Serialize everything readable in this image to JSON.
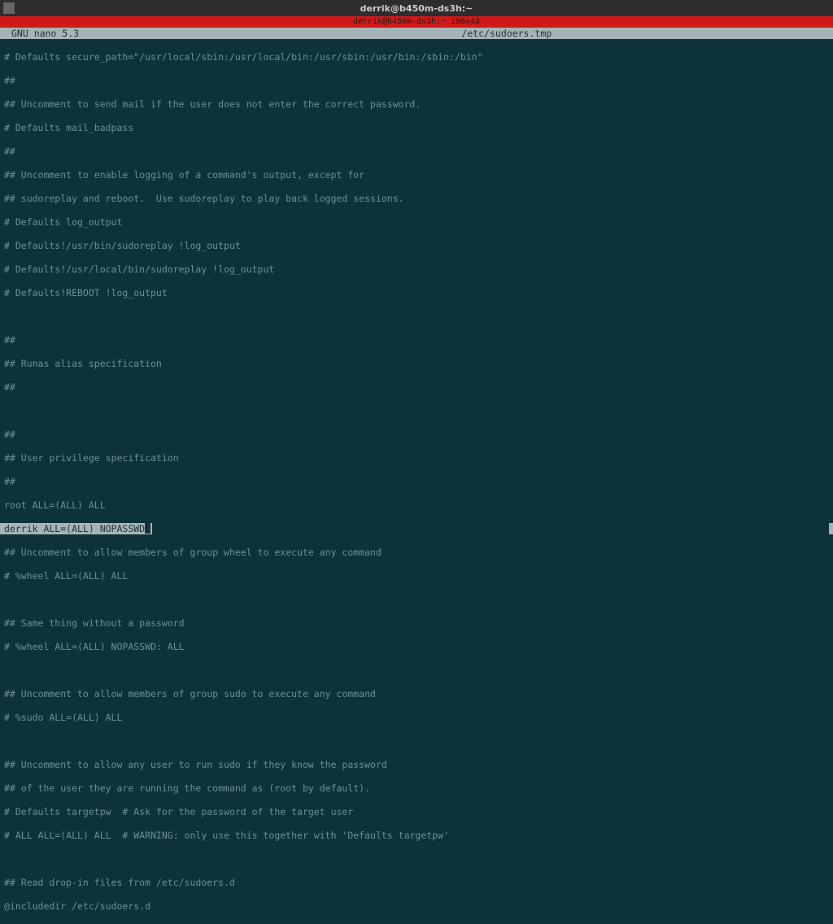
{
  "titlebar": {
    "title": "derrik@b450m-ds3h:~"
  },
  "redStripe": {
    "text": "derrik@b450m-ds3h:~ 190x43"
  },
  "nanoHeader": {
    "version": "GNU nano 5.3",
    "filename": "/etc/sudoers.tmp"
  },
  "lines": {
    "l1": "# Defaults secure_path=\"/usr/local/sbin:/usr/local/bin:/usr/sbin:/usr/bin:/sbin:/bin\"",
    "l2": "##",
    "l3": "## Uncomment to send mail if the user does not enter the correct password.",
    "l4": "# Defaults mail_badpass",
    "l5": "##",
    "l6": "## Uncomment to enable logging of a command's output, except for",
    "l7": "## sudoreplay and reboot.  Use sudoreplay to play back logged sessions.",
    "l8": "# Defaults log_output",
    "l9": "# Defaults!/usr/bin/sudoreplay !log_output",
    "l10": "# Defaults!/usr/local/bin/sudoreplay !log_output",
    "l11": "# Defaults!REBOOT !log_output",
    "l12": "",
    "l13": "##",
    "l14": "## Runas alias specification",
    "l15": "##",
    "l16": "",
    "l17": "##",
    "l18": "## User privilege specification",
    "l19": "##",
    "l20": "root ALL=(ALL) ALL",
    "l21": "derrik ALL=(ALL) NOPASSWD",
    "l22": "## Uncomment to allow members of group wheel to execute any command",
    "l23": "# %wheel ALL=(ALL) ALL",
    "l24": "",
    "l25": "## Same thing without a password",
    "l26": "# %wheel ALL=(ALL) NOPASSWD: ALL",
    "l27": "",
    "l28": "## Uncomment to allow members of group sudo to execute any command",
    "l29": "# %sudo ALL=(ALL) ALL",
    "l30": "",
    "l31": "## Uncomment to allow any user to run sudo if they know the password",
    "l32": "## of the user they are running the command as (root by default).",
    "l33": "# Defaults targetpw  # Ask for the password of the target user",
    "l34": "# ALL ALL=(ALL) ALL  # WARNING: only use this together with 'Defaults targetpw'",
    "l35": "",
    "l36": "## Read drop-in files from /etc/sudoers.d",
    "l37": "@includedir /etc/sudoers.d"
  }
}
